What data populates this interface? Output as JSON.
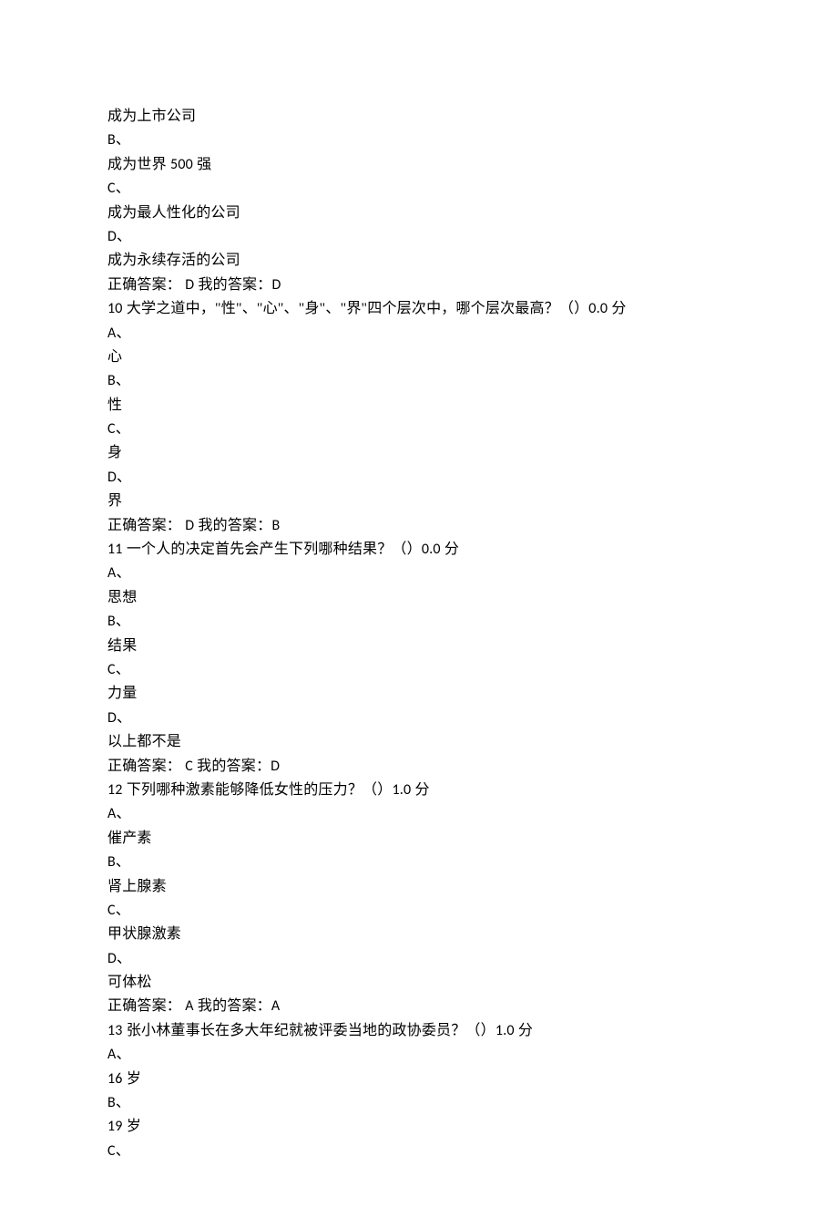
{
  "lines": [
    "成为上市公司",
    "B、",
    "成为世界 500 强",
    "C、",
    "成为最人性化的公司",
    "D、",
    "成为永续存活的公司",
    "正确答案： D  我的答案：D",
    "10 大学之道中，\"性\"、\"心\"、\"身\"、\"界\"四个层次中，哪个层次最高？（）0.0  分",
    "A、",
    "心",
    "B、",
    "性",
    "C、",
    "身",
    "D、",
    "界",
    "正确答案： D  我的答案：B",
    "11 一个人的决定首先会产生下列哪种结果？（）0.0  分",
    "A、",
    "思想",
    "B、",
    "结果",
    "C、",
    "力量",
    "D、",
    "以上都不是",
    "正确答案： C  我的答案：D",
    "12 下列哪种激素能够降低女性的压力？（）1.0  分",
    "A、",
    "催产素",
    "B、",
    "肾上腺素",
    "C、",
    "甲状腺激素",
    "D、",
    "可体松",
    "正确答案： A  我的答案：A",
    "13 张小林董事长在多大年纪就被评委当地的政协委员？（）1.0  分",
    "A、",
    "16 岁",
    "B、",
    "19 岁",
    "C、"
  ]
}
